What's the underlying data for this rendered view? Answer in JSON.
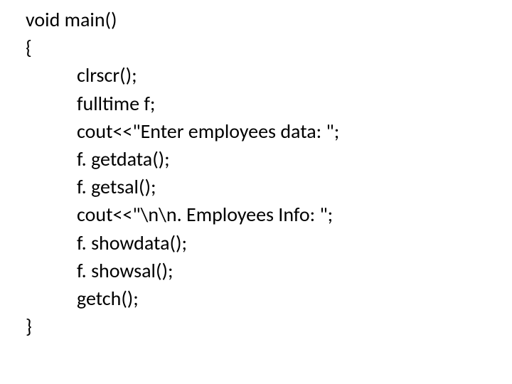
{
  "code": {
    "line1": "void main()",
    "line2": "{",
    "line3": "clrscr();",
    "line4": "fulltime f;",
    "line5": "cout<<\"Enter employees data: \";",
    "line6": "f. getdata();",
    "line7": "f. getsal();",
    "line8": "cout<<\"\\n\\n. Employees Info: \";",
    "line9": "f. showdata();",
    "line10": "f. showsal();",
    "line11": "getch();",
    "line12": "}"
  }
}
